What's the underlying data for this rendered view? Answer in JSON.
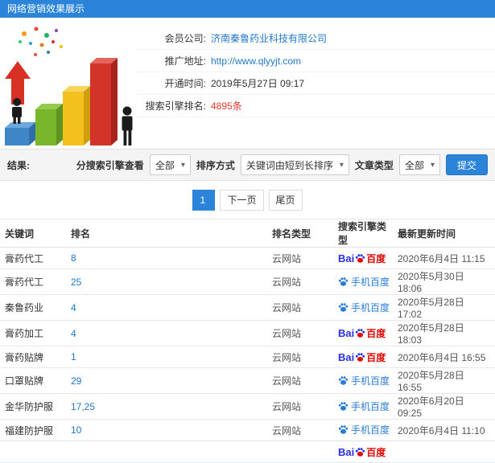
{
  "header": {
    "title": "网络营销效果展示"
  },
  "account": {
    "company_label": "会员公司:",
    "company": "济南秦鲁药业科技有限公司",
    "url_label": "推广地址:",
    "url": "http://www.qlyyjt.com",
    "open_label": "开通时间:",
    "open_time": "2019年5月27日 09:17",
    "rank_label": "搜索引擎排名:",
    "rank_count": "4895条"
  },
  "filters": {
    "result_label": "结果:",
    "engine_label": "分搜索引擎查看",
    "engine_value": "全部",
    "sort_label": "排序方式",
    "sort_value": "关键词由短到长排序",
    "article_label": "文章类型",
    "article_value": "全部",
    "submit_label": "提交"
  },
  "pagination": {
    "current": "1",
    "next": "下一页",
    "last": "尾页"
  },
  "table": {
    "headers": [
      "关键词",
      "排名",
      "排名类型",
      "搜索引擎类型",
      "最新更新时间"
    ],
    "rows": [
      {
        "keyword": "膏药代工",
        "rank": "8",
        "rank_type": "云网站",
        "engine": "pc",
        "updated": "2020年6月4日 11:15"
      },
      {
        "keyword": "膏药代工",
        "rank": "25",
        "rank_type": "云网站",
        "engine": "mobile",
        "updated": "2020年5月30日 18:06"
      },
      {
        "keyword": "秦鲁药业",
        "rank": "4",
        "rank_type": "云网站",
        "engine": "mobile",
        "updated": "2020年5月28日 17:02"
      },
      {
        "keyword": "膏药加工",
        "rank": "4",
        "rank_type": "云网站",
        "engine": "pc",
        "updated": "2020年5月28日 18:03"
      },
      {
        "keyword": "膏药贴牌",
        "rank": "1",
        "rank_type": "云网站",
        "engine": "pc",
        "updated": "2020年6月4日 16:55"
      },
      {
        "keyword": "口罩贴牌",
        "rank": "29",
        "rank_type": "云网站",
        "engine": "mobile",
        "updated": "2020年5月28日 16:55"
      },
      {
        "keyword": "金华防护服",
        "rank": "17,25",
        "rank_type": "云网站",
        "engine": "mobile",
        "updated": "2020年6月20日 09:25"
      },
      {
        "keyword": "福建防护服",
        "rank": "10",
        "rank_type": "云网站",
        "engine": "mobile",
        "updated": "2020年6月4日 11:10"
      },
      {
        "keyword": "",
        "rank": "",
        "rank_type": "",
        "engine": "pc",
        "updated": ""
      }
    ]
  },
  "engines": {
    "pc": {
      "latin": "Bai",
      "cn": "百度"
    },
    "mobile": {
      "label": "手机百度"
    }
  },
  "colors": {
    "accent": "#2b84d8",
    "link": "#2478c8",
    "danger": "#e4392c",
    "baidu_blue": "#2932e1",
    "baidu_red": "#e10601",
    "mobile_blue": "#2b7bd9"
  }
}
